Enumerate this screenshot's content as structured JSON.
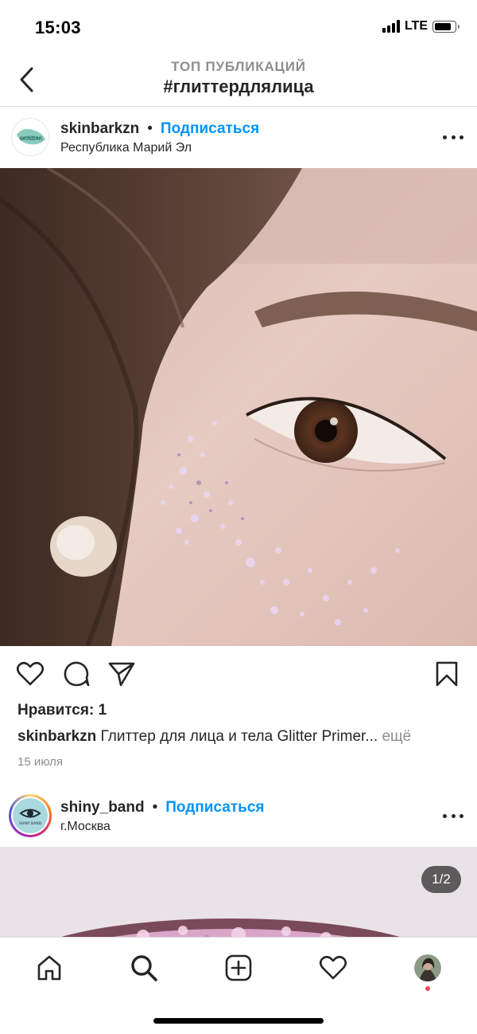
{
  "status_bar": {
    "time": "15:03",
    "network": "LTE"
  },
  "header": {
    "subtitle": "ТОП ПУБЛИКАЦИЙ",
    "title": "#глиттердлялица"
  },
  "posts": [
    {
      "username": "skinbarkzn",
      "separator": "•",
      "follow_label": "Подписаться",
      "location": "Республика Марий Эл",
      "avatar_text": "SKINBAR",
      "likes_text": "Нравится: 1",
      "caption_text": "Глиттер для лица и тела Glitter Primer...",
      "more_label": "ещё",
      "date": "15 июля"
    },
    {
      "username": "shiny_band",
      "separator": "•",
      "follow_label": "Подписаться",
      "location": "г.Москва",
      "avatar_text": "SHINY BAND",
      "carousel_counter": "1/2"
    }
  ],
  "icons": {
    "back": "chevron-left-icon",
    "like": "heart-icon",
    "comment": "comment-icon",
    "share": "paper-plane-icon",
    "save": "bookmark-icon",
    "more": "more-horizontal-icon",
    "tabs": [
      "home-icon",
      "search-icon",
      "add-post-icon",
      "activity-heart-icon",
      "profile-avatar"
    ]
  },
  "colors": {
    "accent": "#0095f6",
    "text": "#262626",
    "muted": "#8e8e8e",
    "notification": "#ed4956"
  }
}
